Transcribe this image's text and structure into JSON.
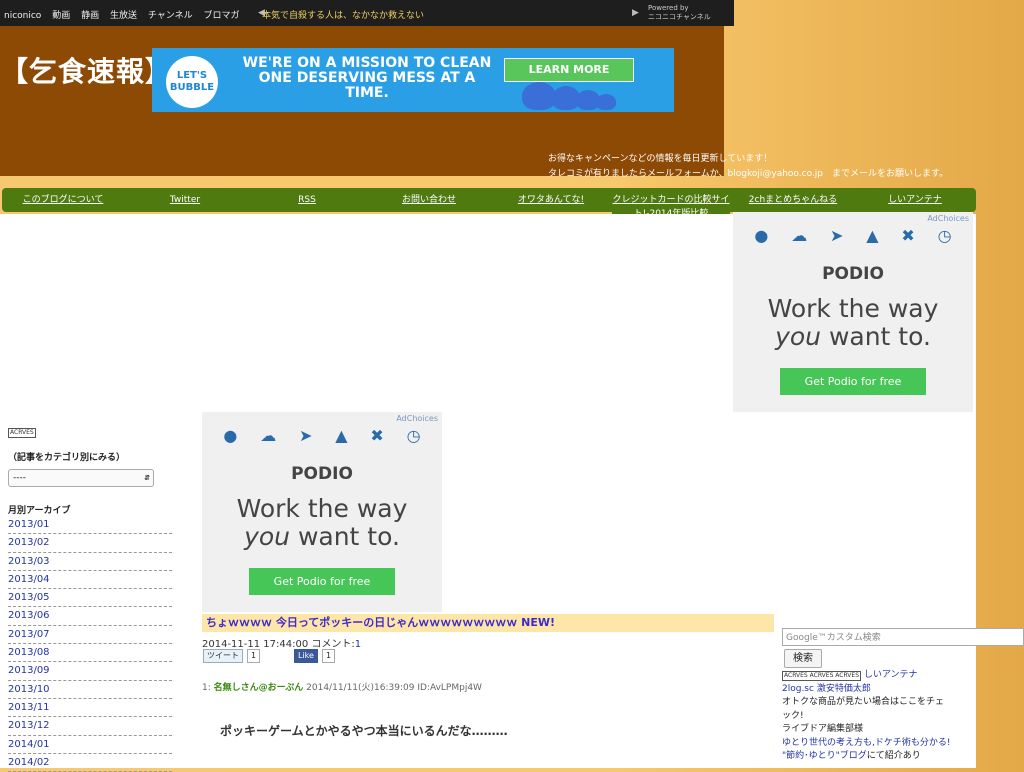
{
  "nicobar": {
    "nav": [
      "niconico",
      "動画",
      "静画",
      "生放送",
      "チャンネル",
      "ブロマガ"
    ],
    "ticker": "本気で自殺する人は、なかなか救えない",
    "arrow_left": "◀",
    "arrow_right": "▶",
    "powered_line1": "Powered by",
    "powered_line2": "ニコニコチャンネル"
  },
  "header": {
    "logo": "【乞食速報】",
    "info_line1": "お得なキャンペーンなどの情報を毎日更新しています！",
    "info_line2": "タレコミが有りましたらメールフォームか、blogkoji@yahoo.co.jp　までメールをお願いします。"
  },
  "banner": {
    "bubble": "LET'S BUBBLE",
    "message": "WE'RE ON A MISSION TO CLEAN ONE DESERVING MESS AT A TIME.",
    "cta": "LEARN MORE"
  },
  "tabs": [
    {
      "label": "このブログについて"
    },
    {
      "label": "Twitter"
    },
    {
      "label": "RSS"
    },
    {
      "label": "お問い合わせ"
    },
    {
      "label": "オワタあんてな!"
    },
    {
      "label": "クレジットカードの比較サイト!-2014年版比較"
    },
    {
      "label": "2chまとめちゃんねる"
    },
    {
      "label": "しいアンテナ"
    }
  ],
  "ad": {
    "adchoices": "AdChoices",
    "brand": "PODIO",
    "line1": "Work the way",
    "line2_em": "you",
    "line2_rest": " want to.",
    "button": "Get Podio for free"
  },
  "sidebar": {
    "badge": "ACRVES",
    "category_label": "（記事をカテゴリ別にみる）",
    "category_value": "----",
    "archive_label": "月別アーカイブ",
    "archives": [
      "2013/01",
      "2013/02",
      "2013/03",
      "2013/04",
      "2013/05",
      "2013/06",
      "2013/07",
      "2013/08",
      "2013/09",
      "2013/10",
      "2013/11",
      "2013/12",
      "2014/01",
      "2014/02"
    ]
  },
  "article": {
    "title": "ちょｗｗｗｗ 今日ってポッキーの日じゃんｗｗｗｗｗｗｗｗｗ NEW!",
    "date": "2014-11-11 17:44:00",
    "comment_label": "コメント:",
    "comment_count": "1",
    "tweet_label": "ツイート",
    "tweet_count": "1",
    "like_label": "Like",
    "like_count": "1",
    "post_num": "1:",
    "post_name": "名無しさん@おーぷん",
    "post_meta": "2014/11/11(火)16:39:09 ID:AvLPMpj4W",
    "body": "ポッキーゲームとかやるやつ本当にいるんだな………"
  },
  "right": {
    "search_placeholder": "Google™カスタム検索",
    "search_button": "検索",
    "badges": "ACRVES ACRVES ACRVES",
    "antenna": "しいアンテナ",
    "twolog_prefix": "2log.sc",
    "twolog_link": "激安特価太郎",
    "line_a": "オトクな商品が見たい場合はここをチェック!",
    "line_b": "ライブドア編集部様",
    "line_c": "ゆとり世代の考え方も,ドケチ術も分かる! \"節約･ゆとり\"ブログ",
    "line_c_rest": "にて紹介あり"
  }
}
